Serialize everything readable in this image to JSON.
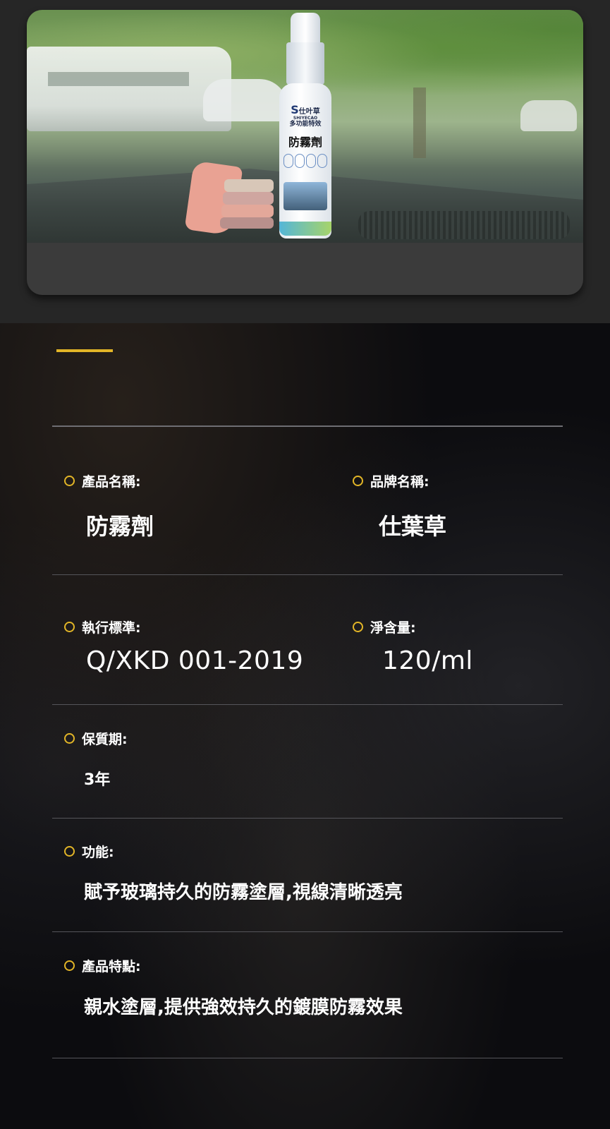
{
  "product_image": {
    "bottle_brand_text": "仕叶草",
    "bottle_brand_en": "SHIYECAO",
    "bottle_subtitle": "多功能特效",
    "bottle_name": "防霧劑"
  },
  "specs": {
    "product_name": {
      "label": "產品名稱:",
      "value": "防霧劑"
    },
    "brand_name": {
      "label": "品牌名稱:",
      "value": "仕葉草"
    },
    "standard": {
      "label": "執行標準:",
      "value": "Q/XKD 001-2019"
    },
    "net_content": {
      "label": "淨含量:",
      "value": "120/ml"
    },
    "shelf_life": {
      "label": "保質期:",
      "value": "3年"
    },
    "function": {
      "label": "功能:",
      "value": "賦予玻璃持久的防霧塗層,視線清晰透亮"
    },
    "features": {
      "label": "產品特點:",
      "value": "親水塗層,提供強效持久的鍍膜防霧效果"
    }
  },
  "colors": {
    "accent": "#e2b527",
    "background": "#0c0c0f",
    "card": "#3b3b3b"
  }
}
